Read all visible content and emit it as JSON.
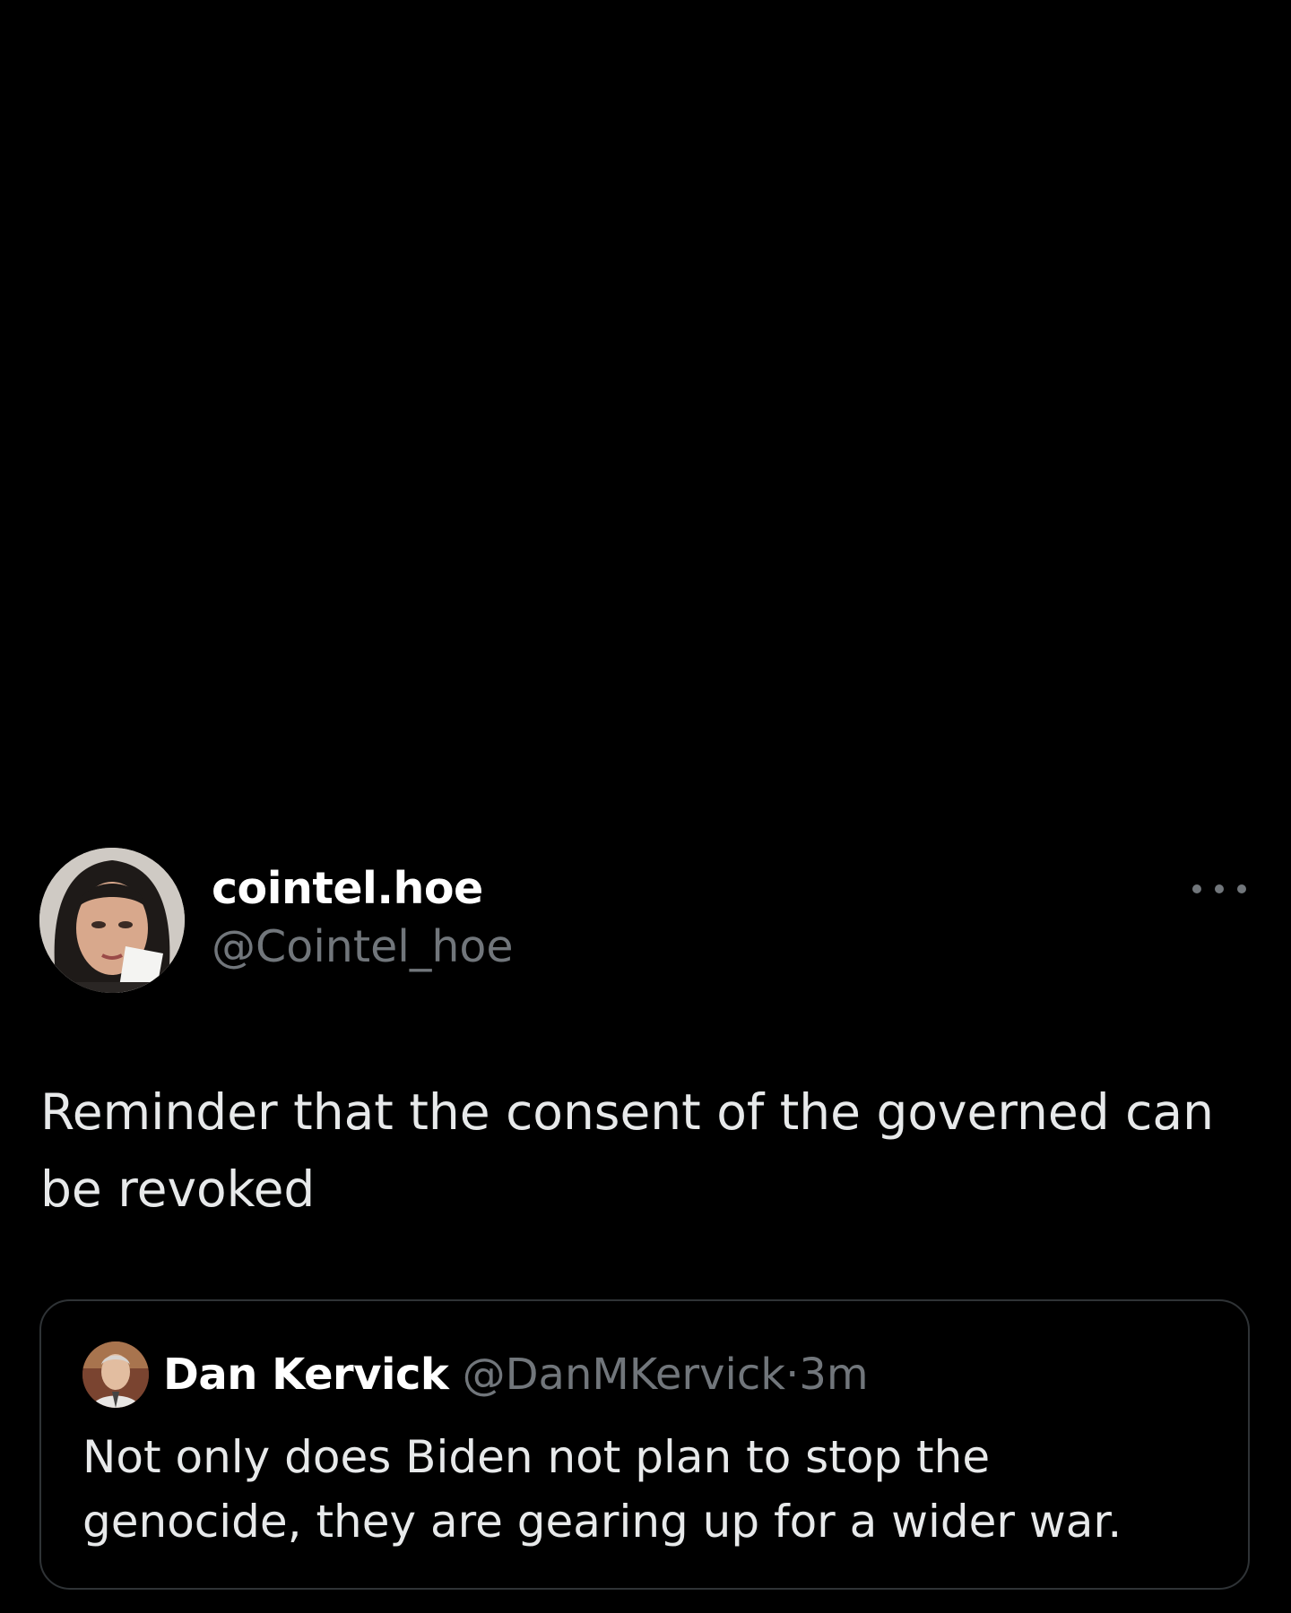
{
  "post": {
    "author": {
      "display_name": "cointel.hoe",
      "handle": "@Cointel_hoe"
    },
    "text": "Reminder that the consent of the governed can be revoked",
    "more_icon": "more-horizontal-icon"
  },
  "quote": {
    "author": {
      "display_name": "Dan Kervick",
      "handle": "@DanMKervick",
      "separator": "·",
      "time": "3m"
    },
    "text": "Not only does Biden not plan to stop the genocide, they are gearing up for a wider war."
  },
  "colors": {
    "background": "#000000",
    "primary_text": "#e7e9ea",
    "secondary_text": "#71767b",
    "border": "#2f3336"
  }
}
